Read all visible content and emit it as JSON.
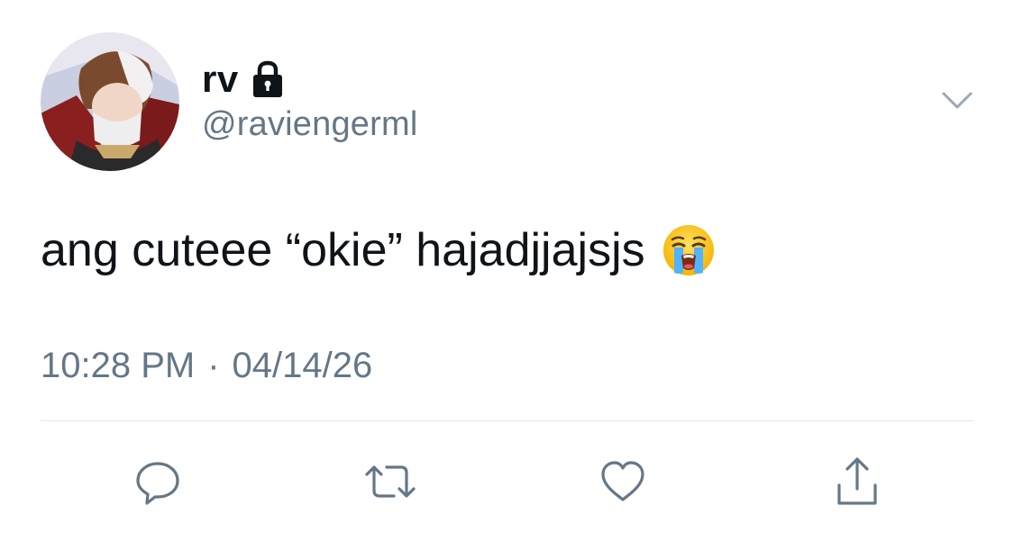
{
  "tweet": {
    "display_name": "rv",
    "handle": "@raviengerml",
    "text": "ang cuteee “okie” hajadjjajsjs",
    "emoji": "loudly-crying-face",
    "time": "10:28 PM",
    "separator": "·",
    "date": "04/14/26",
    "protected_account": true
  },
  "icons": {
    "lock": "lock-icon",
    "menu": "chevron-down-icon",
    "reply": "reply-icon",
    "retweet": "retweet-icon",
    "like": "heart-icon",
    "share": "share-icon"
  },
  "colors": {
    "text_primary": "#0f1419",
    "text_secondary": "#657786",
    "divider": "#e1e8ed",
    "icon_gray": "#657786"
  }
}
